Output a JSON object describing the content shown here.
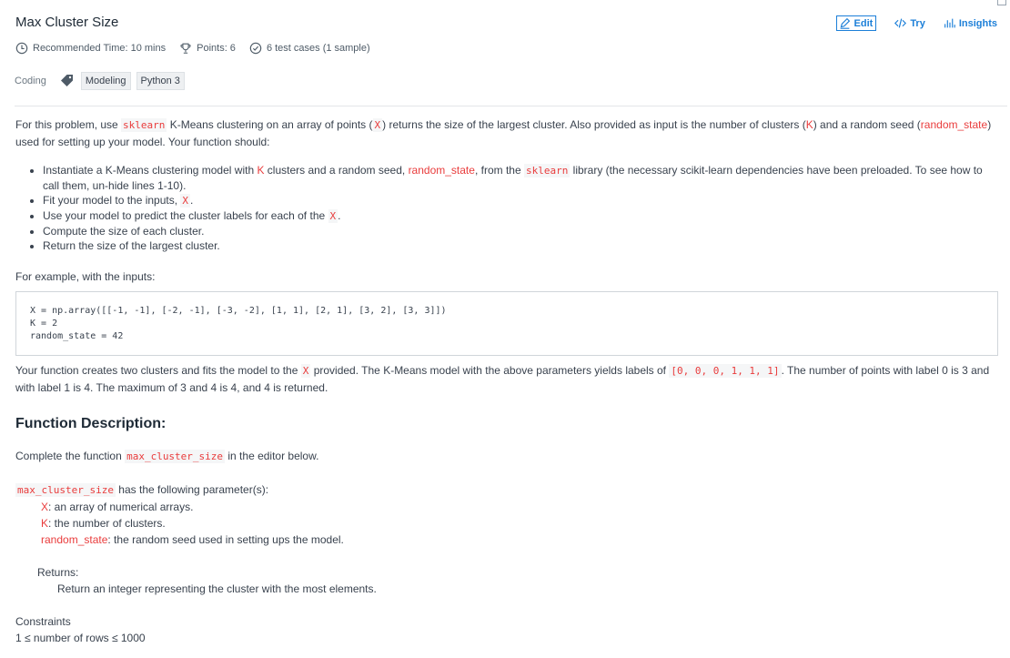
{
  "title": "Max Cluster Size",
  "actions": {
    "edit": "Edit",
    "try": "Try",
    "insights": "Insights"
  },
  "meta": {
    "time": "Recommended Time: 10 mins",
    "points": "Points: 6",
    "tests": "6 test cases (1 sample)"
  },
  "tags": {
    "label": "Coding",
    "items": [
      "Modeling",
      "Python 3"
    ]
  },
  "intro": {
    "a": "For this problem, use ",
    "lib": "sklearn",
    "b": " K-Means clustering on an array of points (",
    "x": "X",
    "c": ") returns the size of the largest cluster.  Also provided as input is the number of clusters (",
    "k": "K",
    "d": ") and a random seed (",
    "rs": "random_state",
    "e": ") used for setting up your model.  Your function should:"
  },
  "bullets": {
    "b1a": "Instantiate a K-Means clustering model with ",
    "b1k": "K",
    "b1b": " clusters and a random seed, ",
    "b1rs": "random_state",
    "b1c": ", from the ",
    "b1lib": "sklearn",
    "b1d": " library (the necessary scikit-learn dependencies have been preloaded.  To see how to call them, un-hide lines 1-10).",
    "b2a": "Fit your model to the inputs, ",
    "b2x": "X",
    "b2b": ".",
    "b3a": "Use your model to predict the cluster labels for each of the ",
    "b3x": "X",
    "b3b": ".",
    "b4": "Compute the size of each cluster.",
    "b5": "Return the size of the largest cluster."
  },
  "example": {
    "intro": "For example, with the inputs:",
    "line1": "X = np.array([[-1, -1], [-2, -1], [-3, -2], [1, 1], [2, 1], [3, 2], [3, 3]])",
    "line2": "K = 2",
    "line3": "random_state = 42",
    "after_a": "Your function creates two clusters and fits the model to the ",
    "after_x": "X",
    "after_b": " provided.  The K-Means model with the above parameters yields labels of ",
    "after_labels": "[0, 0, 0, 1, 1, 1]",
    "after_c": ".  The number of points with label 0 is 3 and with label 1 is 4.  The maximum of 3 and 4 is 4, and 4 is returned."
  },
  "func": {
    "heading": "Function Description:",
    "complete_a": "Complete the function ",
    "fname": "max_cluster_size",
    "complete_b": " in the editor below.",
    "params_fname": "max_cluster_size",
    "params_intro": " has the following parameter(s):",
    "p1_name": "X",
    "p1_desc": ":  an array of numerical arrays.",
    "p2_name": "K",
    "p2_desc": ":  the number of clusters.",
    "p3_name": "random_state",
    "p3_desc": ":  the random seed used in setting ups the model.",
    "returns_label": "Returns:",
    "returns_desc": "Return an integer representing the cluster with the most elements."
  },
  "constraints": {
    "label": "Constraints",
    "c1": "1 ≤ number of rows ≤ 1000"
  },
  "colors": {
    "accent": "#1c7fd8",
    "code_red": "#e93c3c"
  }
}
